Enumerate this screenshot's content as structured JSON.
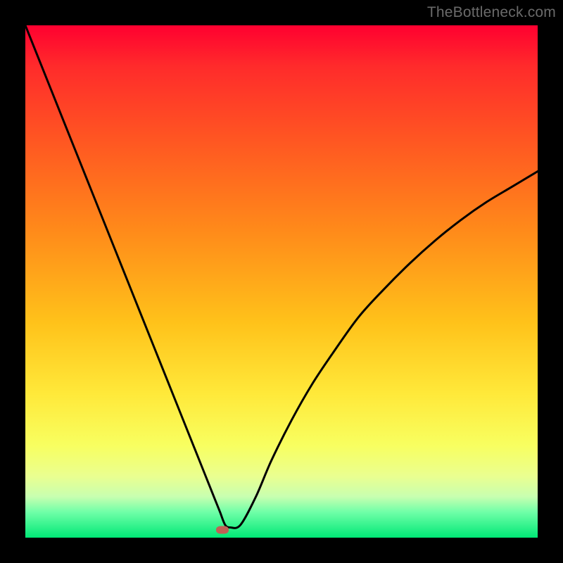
{
  "watermark": "TheBottleneck.com",
  "colors": {
    "frame": "#000000",
    "curve": "#000000",
    "marker": "#c06055"
  },
  "chart_data": {
    "type": "line",
    "title": "",
    "xlabel": "",
    "ylabel": "",
    "xlim": [
      0,
      100
    ],
    "ylim": [
      0,
      100
    ],
    "grid": false,
    "legend": false,
    "series": [
      {
        "name": "bottleneck-curve",
        "x": [
          0,
          5,
          10,
          15,
          20,
          25,
          30,
          33,
          35,
          36,
          37,
          38,
          39,
          40,
          42,
          45,
          48,
          52,
          56,
          60,
          65,
          70,
          75,
          80,
          85,
          90,
          95,
          100
        ],
        "y": [
          100,
          87.5,
          75,
          62.5,
          50,
          37.5,
          25,
          17.5,
          12.5,
          10,
          7.5,
          5,
          2.5,
          2,
          2.5,
          8,
          15,
          23,
          30,
          36,
          43,
          48.5,
          53.5,
          58,
          62,
          65.5,
          68.5,
          71.5
        ]
      }
    ],
    "annotations": [
      {
        "name": "min-marker",
        "x": 38.5,
        "y": 1.5
      }
    ],
    "background_gradient": {
      "direction": "top-to-bottom",
      "stops": [
        {
          "pos": 0.0,
          "color": "#ff0030"
        },
        {
          "pos": 0.08,
          "color": "#ff2b2b"
        },
        {
          "pos": 0.22,
          "color": "#ff5522"
        },
        {
          "pos": 0.4,
          "color": "#ff8a1a"
        },
        {
          "pos": 0.58,
          "color": "#ffc21a"
        },
        {
          "pos": 0.72,
          "color": "#ffe93a"
        },
        {
          "pos": 0.82,
          "color": "#f8ff60"
        },
        {
          "pos": 0.88,
          "color": "#eaff90"
        },
        {
          "pos": 0.92,
          "color": "#c8ffb0"
        },
        {
          "pos": 0.95,
          "color": "#70ffa8"
        },
        {
          "pos": 1.0,
          "color": "#00e876"
        }
      ]
    }
  }
}
